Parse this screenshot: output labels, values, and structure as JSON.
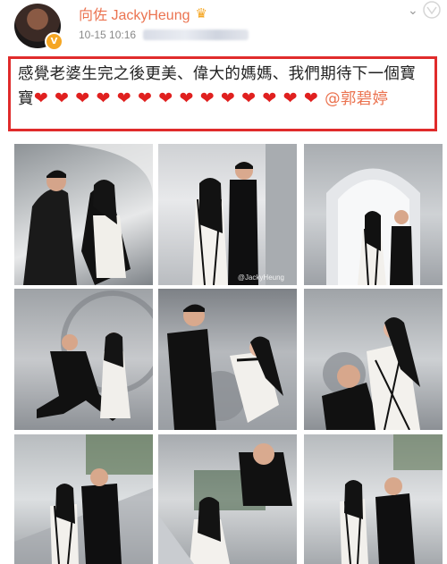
{
  "post": {
    "username": "向佐 JackyHeung",
    "timestamp": "10-15 10:16",
    "text": "感覺老婆生完之後更美、偉大的媽媽、我們期待下一個寶寶",
    "heart_count": 14,
    "mention": "@郭碧婷"
  },
  "icons": {
    "verified": "orange-v-badge",
    "crown": "crown-icon",
    "more": "chevron-down-icon",
    "heart": "red-heart-emoji"
  },
  "photos": {
    "watermark_text": "@JackyHeung"
  },
  "colors": {
    "username": "#eb7350",
    "highlight_box": "#e02b2b",
    "heart": "#e0201f",
    "timestamp": "#888888"
  }
}
